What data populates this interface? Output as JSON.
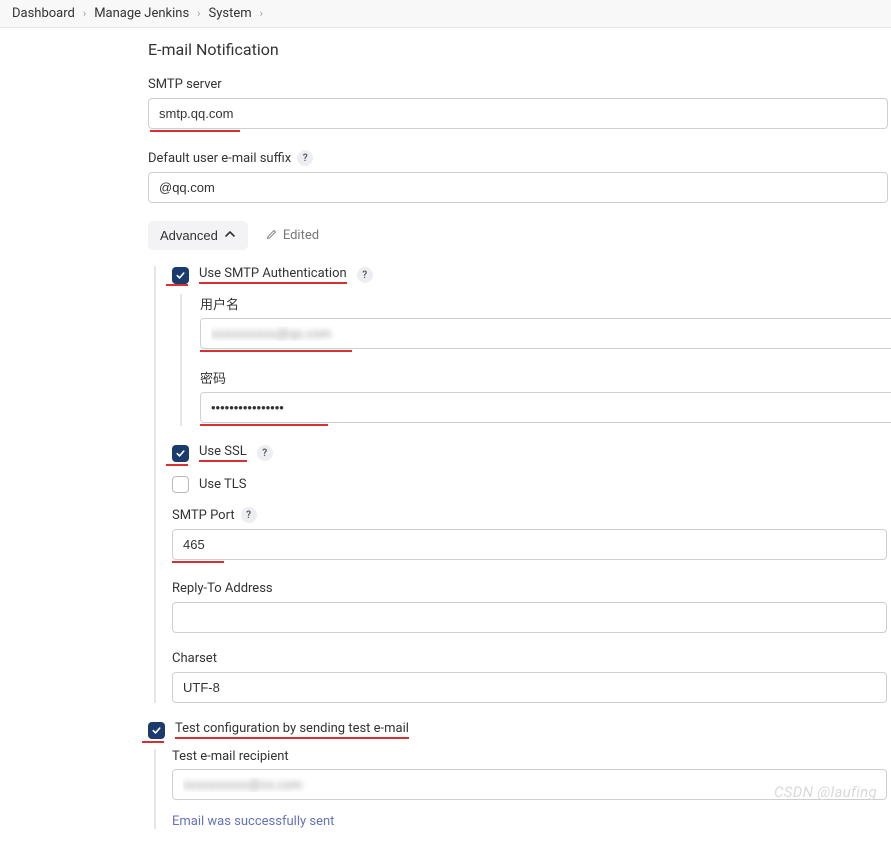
{
  "breadcrumb": {
    "items": [
      "Dashboard",
      "Manage Jenkins",
      "System"
    ]
  },
  "section": {
    "title": "E-mail Notification"
  },
  "smtp": {
    "label": "SMTP server",
    "value": "smtp.qq.com"
  },
  "suffix": {
    "label": "Default user e-mail suffix",
    "value": "@qq.com"
  },
  "advanced": {
    "button": "Advanced",
    "edited": "Edited"
  },
  "auth": {
    "label": "Use SMTP Authentication",
    "user_label": "用户名",
    "user_value": "xxxxxxxxxx@qx.com",
    "pass_label": "密码",
    "pass_value": "••••••••••••••••"
  },
  "ssl": {
    "label": "Use SSL"
  },
  "tls": {
    "label": "Use TLS"
  },
  "port": {
    "label": "SMTP Port",
    "value": "465"
  },
  "replyto": {
    "label": "Reply-To Address",
    "value": ""
  },
  "charset": {
    "label": "Charset",
    "value": "UTF-8"
  },
  "test": {
    "label": "Test configuration by sending test e-mail",
    "recipient_label": "Test e-mail recipient",
    "recipient_value": "xxxxxxxxxx@xx.com",
    "status": "Email was successfully sent"
  },
  "watermark": "CSDN @laufing"
}
